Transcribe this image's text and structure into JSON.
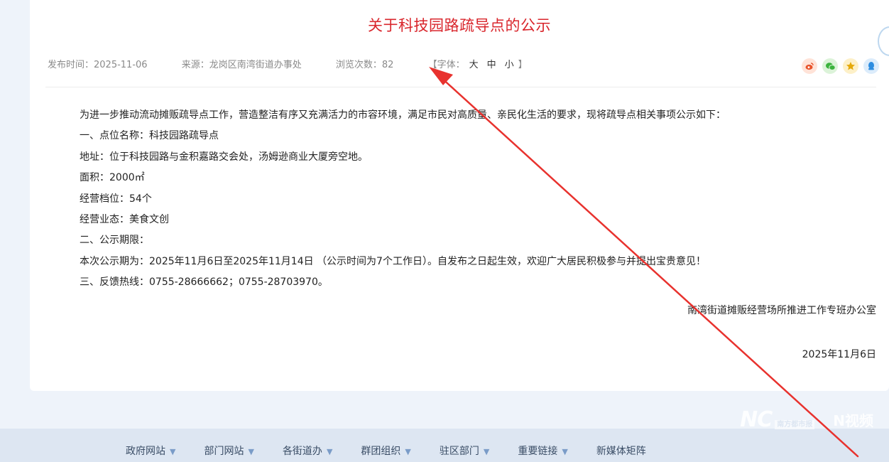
{
  "article": {
    "title": "关于科技园路疏导点的公示",
    "meta": {
      "publish_label": "发布时间：",
      "publish_date": "2025-11-06",
      "source_label": "来源：",
      "source": "龙岗区南湾街道办事处",
      "views_label": "浏览次数：",
      "views": "82",
      "font_open": "【字体：",
      "font_large": "大",
      "font_medium": "中",
      "font_small": "小",
      "font_close": "】"
    },
    "paragraphs": [
      "为进一步推动流动摊贩疏导点工作，营造整洁有序又充满活力的市容环境，满足市民对高质量、亲民化生活的要求，现将疏导点相关事项公示如下：",
      "一、点位名称：科技园路疏导点",
      "地址：位于科技园路与金积嘉路交会处，汤姆逊商业大厦旁空地。",
      "面积：2000㎡",
      "经营档位：54个",
      "经营业态：美食文创",
      "二、公示期限：",
      "本次公示期为：2025年11月6日至2025年11月14日 （公示时间为7个工作日）。自发布之日起生效，欢迎广大居民积极参与并提出宝贵意见！",
      "三、反馈热线：0755-28666662；0755-28703970。"
    ],
    "signature": "南湾街道摊贩经营场所推进工作专班办公室",
    "sign_date": "2025年11月6日"
  },
  "share_icons": [
    "weibo-icon",
    "wechat-icon",
    "favorite-star-icon",
    "qq-icon"
  ],
  "footer": {
    "nav": [
      {
        "label": "政府网站",
        "dropdown": true
      },
      {
        "label": "部门网站",
        "dropdown": true
      },
      {
        "label": "各街道办",
        "dropdown": true
      },
      {
        "label": "群团组织",
        "dropdown": true
      },
      {
        "label": "驻区部门",
        "dropdown": true
      },
      {
        "label": "重要链接",
        "dropdown": true
      },
      {
        "label": "新媒体矩阵",
        "dropdown": false
      }
    ],
    "watermark_nc": "NC",
    "watermark_nc_text": "南方都市报",
    "watermark_nv": "N视频"
  },
  "colors": {
    "title": "#d9262c",
    "annotation_arrow": "#e8322e",
    "footer_bg": "#dde6f2",
    "page_bg": "#eef3fa"
  }
}
